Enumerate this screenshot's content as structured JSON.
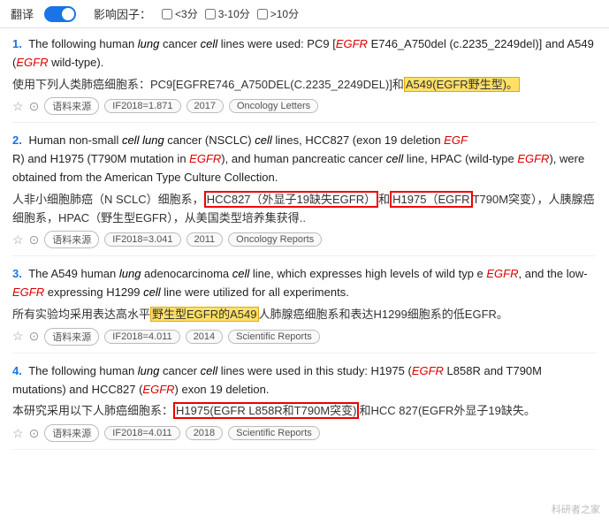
{
  "topbar": {
    "translate_label": "翻译",
    "influence_label": "影响因子：",
    "filter1_label": "<3分",
    "filter2_label": "3-10分",
    "filter3_label": ">10分"
  },
  "results": [
    {
      "number": "1.",
      "en": "The following human lung cancer cell lines were used: PC9 [EGFR E746_A750del (c.2235_2249del)] and A549 (EGFR wild-type).",
      "zh": "使用下列人类肺癌细胞系：PC9[EGFRE746_A750DEL(C.2235_2249DEL)]和A549(EGFR野生型)。",
      "zh_highlight": "A549(EGFR野生型)。",
      "year": "2017",
      "if_score": "IF2018=1.871",
      "journal": "Oncology Letters"
    },
    {
      "number": "2.",
      "en": "Human non-small cell lung cancer (NSCLC) cell lines, HCC827 (exon 19 deletion EGFR) and H1975 (T790M mutation in EGFR), and human pancreatic cancer cell line, HPAC (wild-type EGFR), were obtained from the American Type Culture Collection.",
      "zh": "人非小细胞肺癌（N SCLC）细胞系，HCC827（外显子19缺失EGFR）和H1975（EGFR T790M突变），人胰腺癌细胞系，HPAC（野生型EGFR），从美国类型培养集获得..",
      "zh_highlight1": "HCC827（外显子19缺失EGFR）",
      "zh_highlight2": "H1975（EGFR",
      "year": "2011",
      "if_score": "IF2018=3.041",
      "journal": "Oncology Reports"
    },
    {
      "number": "3.",
      "en": "The A549 human lung adenocarcinoma cell line, which expresses high levels of wild type EGFR, and the low-EGFR expressing H1299 cell line were utilized for all experiments.",
      "zh": "所有实验均采用表达高水平野生型EGFR的A549人肺腺癌细胞系和表达H1299细胞系的低EGFR。",
      "zh_highlight": "野生型EGFR的A549",
      "year": "2014",
      "if_score": "IF2018=4.011",
      "journal": "Scientific Reports"
    },
    {
      "number": "4.",
      "en": "The following human lung cancer cell lines were used in this study: H1975 (EGFR L858R and T790M mutations) and HCC827 (EGFR exon 19 deletion.",
      "zh": "本研究采用以下人肺癌细胞系：H1975(EGFR L858R和T790M突变)和HCC 827(EGFR外显子19缺失。",
      "zh_highlight": "H1975(EGFR L858R和T790M突变)",
      "year": "2018",
      "if_score": "IF2018=4.011",
      "journal": "Scientific Reports"
    }
  ],
  "watermark": "科研者之家"
}
